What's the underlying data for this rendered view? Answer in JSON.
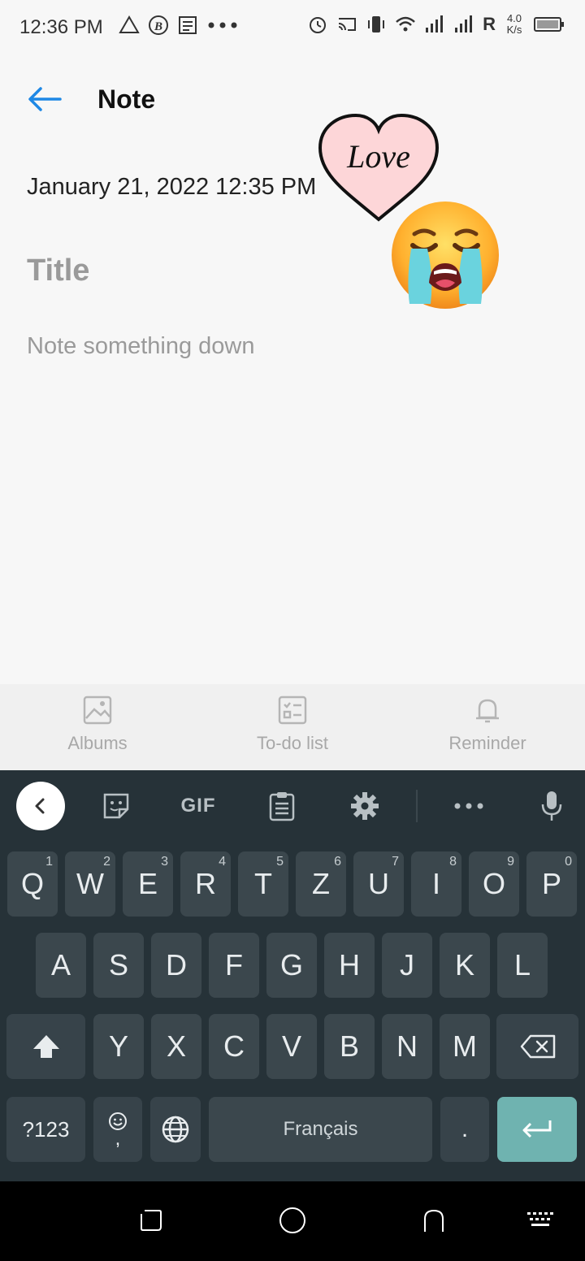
{
  "status_bar": {
    "time": "12:36 PM",
    "speed_top": "4.0",
    "speed_bottom": "K/s",
    "carrier_letter": "R"
  },
  "header": {
    "title": "Note"
  },
  "note": {
    "date": "January 21, 2022 12:35 PM",
    "title_placeholder": "Title",
    "body_placeholder": "Note something down"
  },
  "stickers": {
    "heart_text": "Love"
  },
  "toolbar": {
    "items": [
      {
        "label": "Albums",
        "icon": "image-icon"
      },
      {
        "label": "To-do list",
        "icon": "checklist-icon"
      },
      {
        "label": "Reminder",
        "icon": "bell-icon"
      }
    ]
  },
  "keyboard": {
    "gif_label": "GIF",
    "row1": [
      {
        "key": "Q",
        "hint": "1"
      },
      {
        "key": "W",
        "hint": "2"
      },
      {
        "key": "E",
        "hint": "3"
      },
      {
        "key": "R",
        "hint": "4"
      },
      {
        "key": "T",
        "hint": "5"
      },
      {
        "key": "Z",
        "hint": "6"
      },
      {
        "key": "U",
        "hint": "7"
      },
      {
        "key": "I",
        "hint": "8"
      },
      {
        "key": "O",
        "hint": "9"
      },
      {
        "key": "P",
        "hint": "0"
      }
    ],
    "row2": [
      "A",
      "S",
      "D",
      "F",
      "G",
      "H",
      "J",
      "K",
      "L"
    ],
    "row3": [
      "Y",
      "X",
      "C",
      "V",
      "B",
      "N",
      "M"
    ],
    "symbols_label": "?123",
    "emoji_comma": ",",
    "space_label": "Français",
    "period_label": "."
  },
  "colors": {
    "accent": "#1e88e5",
    "keyboard_bg": "#263238",
    "key_bg": "#3b474d",
    "enter_bg": "#6fb3b0"
  }
}
